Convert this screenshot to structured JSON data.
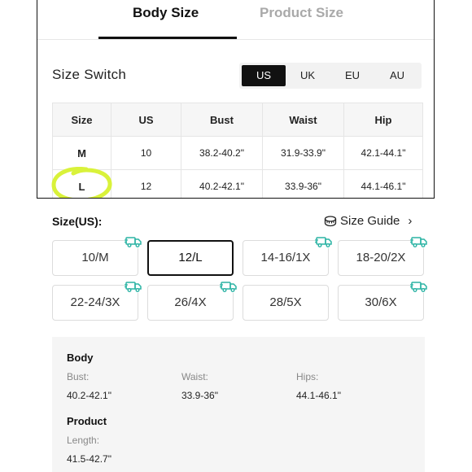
{
  "tabs": {
    "body_size": "Body Size",
    "product_size": "Product Size"
  },
  "size_switch": {
    "label": "Size Switch",
    "options": [
      "US",
      "UK",
      "EU",
      "AU"
    ],
    "selected": "US"
  },
  "chart": {
    "headers": [
      "Size",
      "US",
      "Bust",
      "Waist",
      "Hip"
    ],
    "rows": [
      [
        "M",
        "10",
        "38.2-40.2\"",
        "31.9-33.9\"",
        "42.1-44.1\""
      ],
      [
        "L",
        "12",
        "40.2-42.1\"",
        "33.9-36\"",
        "44.1-46.1\""
      ]
    ]
  },
  "highlight_color": "#d9f23a",
  "sizes": {
    "title": "Size(US):",
    "guide_label": "Size Guide",
    "selected": "12/L",
    "options": [
      {
        "label": "10/M",
        "badge": true
      },
      {
        "label": "12/L",
        "badge": false
      },
      {
        "label": "14-16/1X",
        "badge": true
      },
      {
        "label": "18-20/2X",
        "badge": true
      },
      {
        "label": "22-24/3X",
        "badge": true
      },
      {
        "label": "26/4X",
        "badge": true
      },
      {
        "label": "28/5X",
        "badge": false
      },
      {
        "label": "30/6X",
        "badge": true
      }
    ]
  },
  "info": {
    "body_title": "Body",
    "bust_label": "Bust:",
    "bust_value": "40.2-42.1\"",
    "waist_label": "Waist:",
    "waist_value": "33.9-36\"",
    "hips_label": "Hips:",
    "hips_value": "44.1-46.1\"",
    "product_title": "Product",
    "length_label": "Length:",
    "length_value": "41.5-42.7\""
  },
  "colors": {
    "accent": "#111111",
    "badge": "#2bb3a4",
    "panel": "#f5f5f5"
  }
}
